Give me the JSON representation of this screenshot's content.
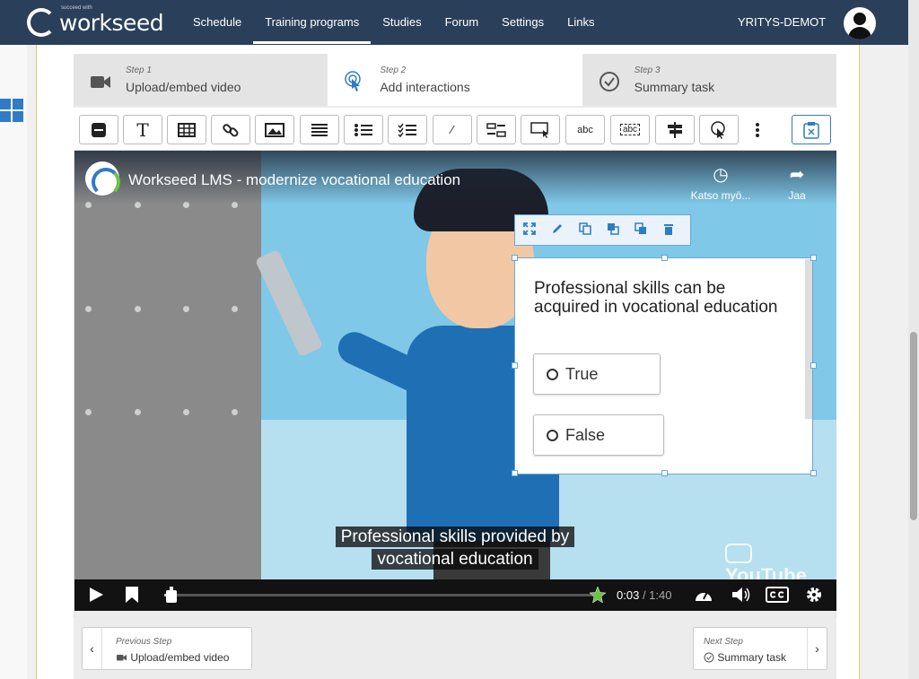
{
  "nav": {
    "logo_text": "workseed",
    "logo_tagline": "succeed with",
    "links": [
      "Schedule",
      "Training programs",
      "Studies",
      "Forum",
      "Settings",
      "Links"
    ],
    "active_link": "Training programs",
    "company": "YRITYS-DEMOT"
  },
  "steps": [
    {
      "num": "Step 1",
      "title": "Upload/embed video",
      "icon": "video-camera-icon"
    },
    {
      "num": "Step 2",
      "title": "Add interactions",
      "icon": "touch-icon"
    },
    {
      "num": "Step 3",
      "title": "Summary task",
      "icon": "check-circle-icon"
    }
  ],
  "toolbar": {
    "text_glyph": "T",
    "fraction_glyph": "⁄",
    "fill_glyph": "abc"
  },
  "video": {
    "title": "Workseed LMS - modernize vocational education",
    "watch_later": "Katso myö...",
    "share": "Jaa",
    "caption_line1": "Professional skills provided by",
    "caption_line2": "vocational education",
    "brand": "YouTube",
    "current_time": "0:03",
    "duration": "/ 1:40",
    "progress": 0.03
  },
  "interaction": {
    "question": "Professional skills can be acquired in vocational education",
    "options": [
      "True",
      "False"
    ]
  },
  "bottom": {
    "prev_small": "Previous Step",
    "prev_label": "Upload/embed video",
    "next_small": "Next Step",
    "next_label": "Summary task"
  }
}
